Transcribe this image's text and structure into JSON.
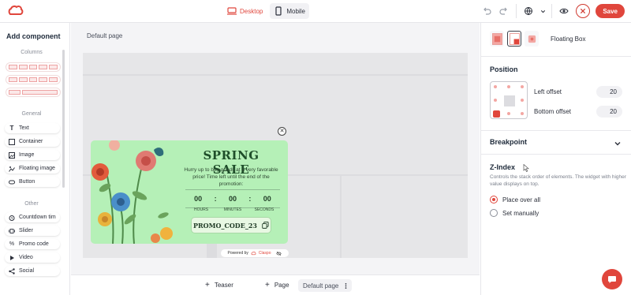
{
  "topbar": {
    "device_desktop": "Desktop",
    "device_mobile": "Mobile",
    "save_label": "Save",
    "accent": "#e0463c"
  },
  "left_panel": {
    "title": "Add component",
    "group_columns": "Columns",
    "group_general": "General",
    "general_items": [
      {
        "label": "Text",
        "icon": "text-icon"
      },
      {
        "label": "Container",
        "icon": "container-icon"
      },
      {
        "label": "Image",
        "icon": "image-icon"
      },
      {
        "label": "Floating image",
        "icon": "floating-image-icon"
      },
      {
        "label": "Button",
        "icon": "button-icon"
      }
    ],
    "group_other": "Other",
    "other_items": [
      {
        "label": "Countdown tim",
        "icon": "countdown-icon"
      },
      {
        "label": "Slider",
        "icon": "slider-icon"
      },
      {
        "label": "Promo code",
        "icon": "percent-icon"
      },
      {
        "label": "Video",
        "icon": "play-icon"
      },
      {
        "label": "Social",
        "icon": "share-icon"
      }
    ]
  },
  "canvas": {
    "page_label": "Default page"
  },
  "popup": {
    "title": "SPRING SALE",
    "text": "Hurry up to buy goods at a very favorable price! Time left until the end of the promotion:",
    "timer": {
      "hours": "00",
      "minutes": "00",
      "seconds": "00"
    },
    "timer_labels": {
      "hours": "HOURS",
      "minutes": "MINUTES",
      "seconds": "SECONDS"
    },
    "promo_code": "PROMO_CODE_23",
    "powered_by": "Powered by",
    "brand": "Claspo",
    "background": "#b5f0b7"
  },
  "bottombar": {
    "teaser": "Teaser",
    "page": "Page",
    "default_page": "Default page"
  },
  "right_panel": {
    "element_type": "Floating Box",
    "position_title": "Position",
    "left_offset_label": "Left offset",
    "left_offset_value": "20",
    "bottom_offset_label": "Bottom offset",
    "bottom_offset_value": "20",
    "breakpoint_title": "Breakpoint",
    "zindex_title": "Z-Index",
    "zindex_desc": "Controls the stack order of elements. The widget with higher value displays on top.",
    "radio_place_over": "Place over all",
    "radio_set_manually": "Set manually",
    "selected_radio": "Place over all"
  }
}
